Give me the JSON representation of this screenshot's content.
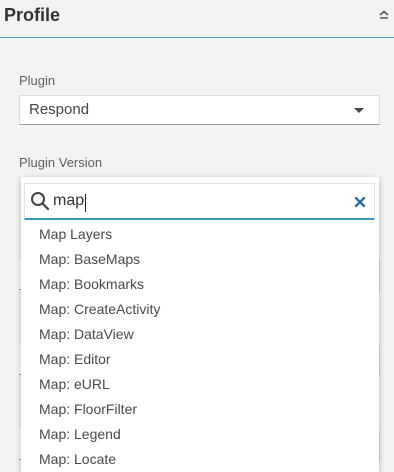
{
  "header": {
    "title": "Profile",
    "collapse_icon": "chevron-up-icon"
  },
  "plugin_field": {
    "label": "Plugin",
    "value": "Respond"
  },
  "plugin_version_field": {
    "label": "Plugin Version"
  },
  "dropdown": {
    "search_value": "map",
    "search_icon": "search-icon",
    "clear_icon": "close-icon",
    "options": [
      {
        "label": "Map Layers"
      },
      {
        "label": "Map: BaseMaps"
      },
      {
        "label": "Map: Bookmarks"
      },
      {
        "label": "Map: CreateActivity"
      },
      {
        "label": "Map: DataView"
      },
      {
        "label": "Map: Editor"
      },
      {
        "label": "Map: eURL"
      },
      {
        "label": "Map: FloorFilter"
      },
      {
        "label": "Map: Legend"
      },
      {
        "label": "Map: Locate"
      }
    ]
  },
  "colors": {
    "accent": "#3b9ac0",
    "header_rule": "#4aa6c2",
    "clear_icon": "#2b6fa3",
    "panel_bg": "#f3f3f3"
  }
}
